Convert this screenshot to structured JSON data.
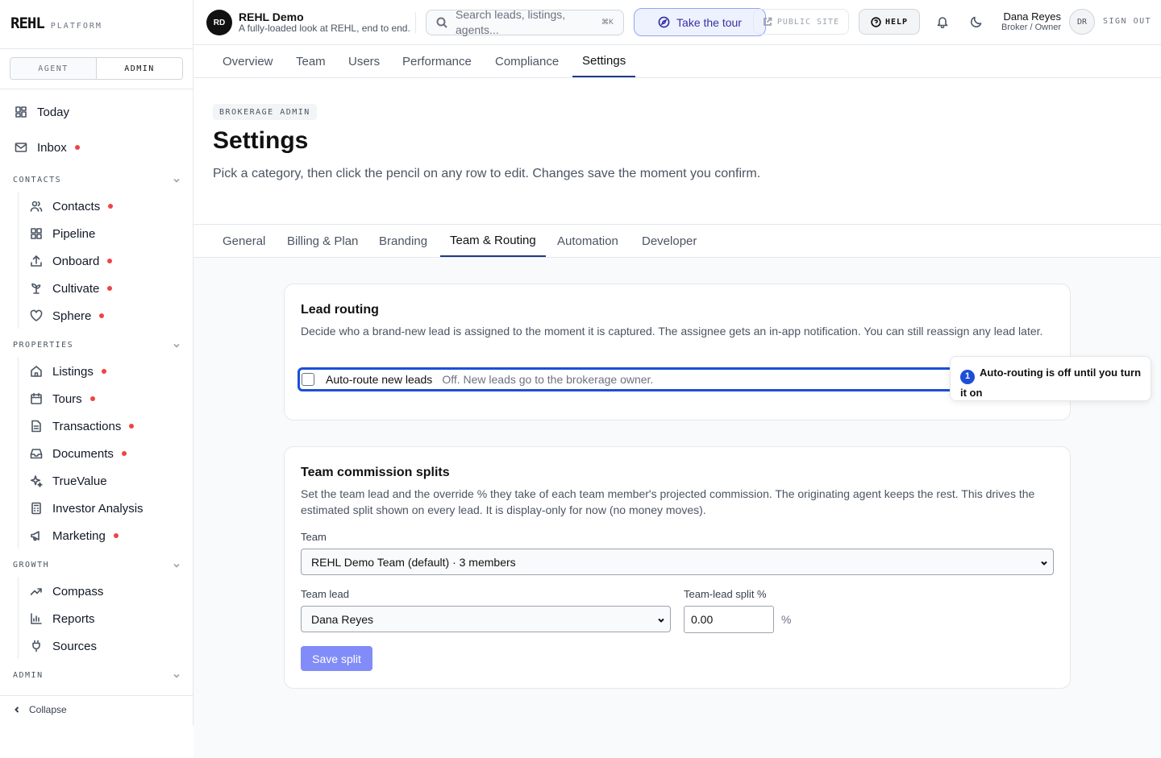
{
  "sidebar": {
    "brand": "REHL",
    "brand_sub": "PLATFORM",
    "role_toggle": {
      "agent": "AGENT",
      "admin": "ADMIN",
      "selected": "ADMIN"
    },
    "top_items": [
      {
        "label": "Today",
        "icon": "dashboard-icon",
        "dot": false
      },
      {
        "label": "Inbox",
        "icon": "mail-icon",
        "dot": true
      }
    ],
    "sections": [
      {
        "title": "CONTACTS",
        "items": [
          {
            "label": "Contacts",
            "icon": "users-icon",
            "dot": true
          },
          {
            "label": "Pipeline",
            "icon": "grid-icon",
            "dot": false
          },
          {
            "label": "Onboard",
            "icon": "upload-icon",
            "dot": true
          },
          {
            "label": "Cultivate",
            "icon": "sprout-icon",
            "dot": true
          },
          {
            "label": "Sphere",
            "icon": "heart-icon",
            "dot": true
          }
        ]
      },
      {
        "title": "PROPERTIES",
        "items": [
          {
            "label": "Listings",
            "icon": "home-icon",
            "dot": true
          },
          {
            "label": "Tours",
            "icon": "calendar-icon",
            "dot": true
          },
          {
            "label": "Transactions",
            "icon": "file-icon",
            "dot": true
          },
          {
            "label": "Documents",
            "icon": "inbox-icon",
            "dot": true
          },
          {
            "label": "TrueValue",
            "icon": "sparkles-icon",
            "dot": false
          },
          {
            "label": "Investor Analysis",
            "icon": "calculator-icon",
            "dot": false
          },
          {
            "label": "Marketing",
            "icon": "megaphone-icon",
            "dot": true
          }
        ]
      },
      {
        "title": "GROWTH",
        "items": [
          {
            "label": "Compass",
            "icon": "trend-icon",
            "dot": false
          },
          {
            "label": "Reports",
            "icon": "bar-chart-icon",
            "dot": false
          },
          {
            "label": "Sources",
            "icon": "plug-icon",
            "dot": false
          }
        ]
      },
      {
        "title": "ADMIN",
        "items": []
      }
    ],
    "collapse_label": "Collapse"
  },
  "topbar": {
    "workspace_initials": "RD",
    "workspace_name": "REHL Demo",
    "workspace_desc": "A fully-loaded look at REHL, end to end.",
    "search_placeholder": "Search leads, listings, agents...",
    "search_shortcut": "⌘K",
    "tour_label": "Take the tour",
    "public_site_label": "PUBLIC SITE",
    "help_label": "HELP",
    "user_name": "Dana Reyes",
    "user_role": "Broker / Owner",
    "user_initials": "DR",
    "sign_out_label": "SIGN OUT"
  },
  "admin_tabs": [
    "Overview",
    "Team",
    "Users",
    "Performance",
    "Compliance",
    "Settings"
  ],
  "admin_tab_active": "Settings",
  "page": {
    "eyebrow": "BROKERAGE ADMIN",
    "title": "Settings",
    "description": "Pick a category, then click the pencil on any row to edit. Changes save the moment you confirm."
  },
  "settings_tabs": [
    "General",
    "Billing & Plan",
    "Branding",
    "Team & Routing",
    "Automation",
    "Developer"
  ],
  "settings_tab_active": "Team & Routing",
  "lead_routing": {
    "title": "Lead routing",
    "description": "Decide who a brand-new lead is assigned to the moment it is captured. The assignee gets an in-app notification. You can still reassign any lead later.",
    "toggle_label": "Auto-route new leads",
    "toggle_checked": false,
    "status_text": "Off. New leads go to the brokerage owner."
  },
  "tooltip": {
    "number": "1",
    "text": "Auto-routing is off until you turn it on"
  },
  "commission": {
    "title": "Team commission splits",
    "description": "Set the team lead and the override % they take of each team member's projected commission. The originating agent keeps the rest. This drives the estimated split shown on every lead. It is display-only for now (no money moves).",
    "team_label": "Team",
    "team_value": "REHL Demo Team (default) · 3 members",
    "lead_label": "Team lead",
    "lead_value": "Dana Reyes",
    "split_label": "Team-lead split %",
    "split_value": "0.00",
    "split_unit": "%",
    "save_label": "Save split"
  },
  "colors": {
    "accent": "#1d4ed8",
    "dot": "#ef4444",
    "save_button": "#818cf8"
  }
}
